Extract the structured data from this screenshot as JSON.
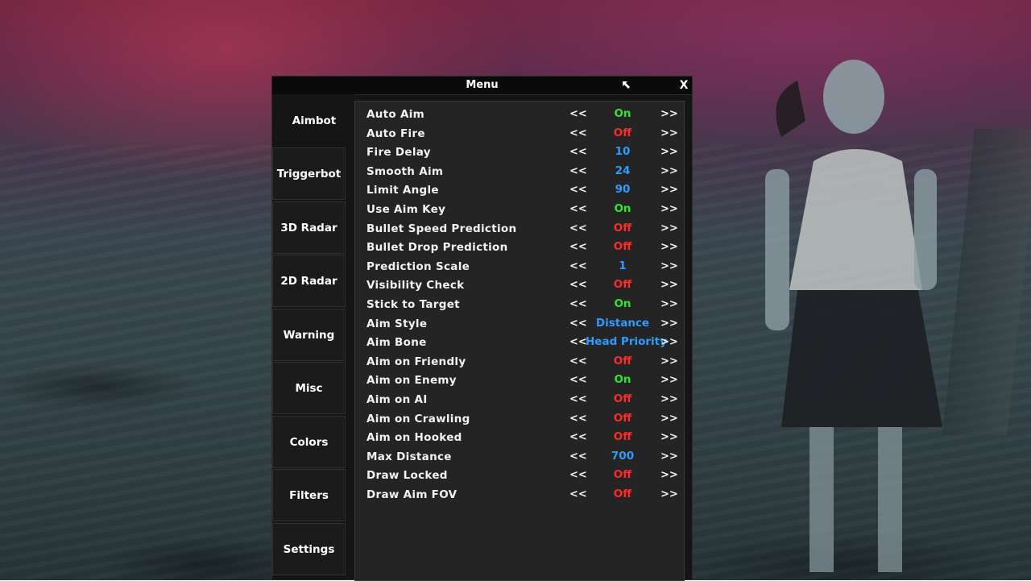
{
  "colors": {
    "on": "#2ee62e",
    "off": "#ff2a2a",
    "number": "#2f9bff",
    "text": "#f2f2f2"
  },
  "menu": {
    "title": "Menu",
    "close_label": "X",
    "move_icon": "resize-arrow-icon"
  },
  "sidebar": {
    "active": "Aimbot",
    "items": [
      {
        "label": "Aimbot"
      },
      {
        "label": "Triggerbot"
      },
      {
        "label": "3D Radar"
      },
      {
        "label": "2D Radar"
      },
      {
        "label": "Warning"
      },
      {
        "label": "Misc"
      },
      {
        "label": "Colors"
      },
      {
        "label": "Filters"
      },
      {
        "label": "Settings"
      }
    ]
  },
  "options": {
    "left_arrow": "<<",
    "right_arrow": ">>",
    "rows": [
      {
        "label": "Auto Aim",
        "value": "On",
        "kind": "on"
      },
      {
        "label": "Auto Fire",
        "value": "Off",
        "kind": "off"
      },
      {
        "label": "Fire Delay",
        "value": "10",
        "kind": "number"
      },
      {
        "label": "Smooth Aim",
        "value": "24",
        "kind": "number"
      },
      {
        "label": "Limit Angle",
        "value": "90",
        "kind": "number"
      },
      {
        "label": "Use Aim Key",
        "value": "On",
        "kind": "on"
      },
      {
        "label": "Bullet Speed Prediction",
        "value": "Off",
        "kind": "off"
      },
      {
        "label": "Bullet Drop Prediction",
        "value": "Off",
        "kind": "off"
      },
      {
        "label": "Prediction Scale",
        "value": "1",
        "kind": "number"
      },
      {
        "label": "Visibility Check",
        "value": "Off",
        "kind": "off"
      },
      {
        "label": "Stick to Target",
        "value": "On",
        "kind": "on"
      },
      {
        "label": "Aim Style",
        "value": "Distance",
        "kind": "number"
      },
      {
        "label": "Aim Bone",
        "value": "Head Priority",
        "kind": "number"
      },
      {
        "label": "Aim on Friendly",
        "value": "Off",
        "kind": "off"
      },
      {
        "label": "Aim on Enemy",
        "value": "On",
        "kind": "on"
      },
      {
        "label": "Aim on AI",
        "value": "Off",
        "kind": "off"
      },
      {
        "label": "Aim on Crawling",
        "value": "Off",
        "kind": "off"
      },
      {
        "label": "Aim on Hooked",
        "value": "Off",
        "kind": "off"
      },
      {
        "label": "Max Distance",
        "value": "700",
        "kind": "number"
      },
      {
        "label": "Draw Locked",
        "value": "Off",
        "kind": "off"
      },
      {
        "label": "Draw Aim FOV",
        "value": "Off",
        "kind": "off"
      }
    ]
  }
}
